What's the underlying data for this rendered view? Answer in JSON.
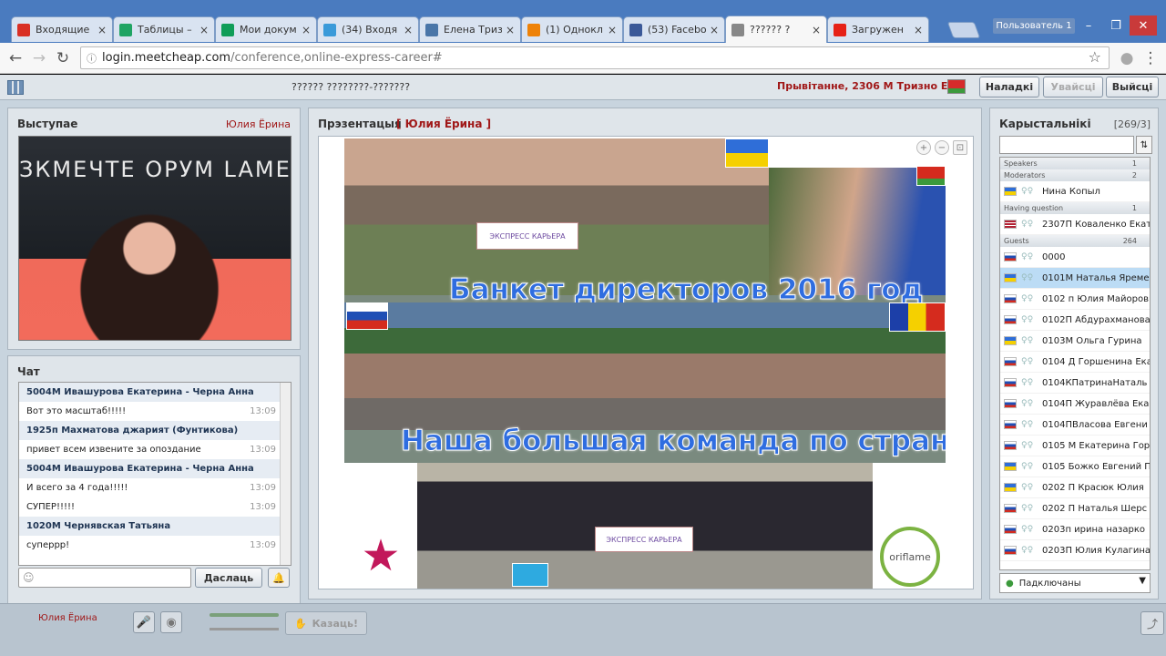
{
  "browser": {
    "tabs": [
      {
        "title": "Входящие",
        "icon": "gmail-icon",
        "color": "#d93025"
      },
      {
        "title": "Таблицы –",
        "icon": "drive-icon",
        "color": "#1fa463"
      },
      {
        "title": "Мои докум",
        "icon": "sheets-icon",
        "color": "#0f9d58"
      },
      {
        "title": "(34) Входя",
        "icon": "mail-icon",
        "color": "#3a9ad9"
      },
      {
        "title": "Елена Триз",
        "icon": "vk-icon",
        "color": "#4a76a8"
      },
      {
        "title": "(1) Однокл",
        "icon": "ok-icon",
        "color": "#ee8208"
      },
      {
        "title": "(53) Facebo",
        "icon": "facebook-icon",
        "color": "#3b5998"
      },
      {
        "title": "?????? ?",
        "icon": "page-icon",
        "color": "#888888"
      },
      {
        "title": "Загружен",
        "icon": "youtube-icon",
        "color": "#e62117"
      }
    ],
    "user_label": "Пользователь 1",
    "url_host": "login.meetcheap.com",
    "url_path": "/conference,online-express-career#"
  },
  "app": {
    "conference_title": "?????? ????????-???????",
    "greeting": "Прывітанне, 2306 М Тризно Е...",
    "buttons": {
      "settings": "Наладкі",
      "login": "Увайсці",
      "exit": "Выйсці"
    }
  },
  "speaker": {
    "title": "Выступае",
    "name": "Юлия Ёрина",
    "banner": "ЗКМЕЧТЕ ОРУМ   LAME"
  },
  "chat": {
    "title": "Чат",
    "messages": [
      {
        "author": "5004М Ивашурова Екатерина - Черна Анна",
        "lines": [
          {
            "text": "Вот это масштаб!!!!!",
            "time": "13:09"
          }
        ]
      },
      {
        "author": "1925п Махматова джарият (Фунтикова)",
        "lines": [
          {
            "text": "привет всем извените за опоздание",
            "time": "13:09"
          }
        ]
      },
      {
        "author": "5004М Ивашурова Екатерина - Черна Анна",
        "lines": [
          {
            "text": "И всего за 4 года!!!!!",
            "time": "13:09"
          },
          {
            "text": "СУПЕР!!!!!",
            "time": "13:09"
          }
        ]
      },
      {
        "author": "1020М Чернявская Татьяна",
        "lines": [
          {
            "text": "суперрр!",
            "time": "13:09"
          }
        ]
      }
    ],
    "send_label": "Даслаць"
  },
  "presentation": {
    "title": "Прэзентацыя",
    "presenter": "[ Юлия Ёрина ]",
    "caption1": "Банкет директоров 2016 год",
    "caption2": "Наша большая команда по странам",
    "banner1": "ЭКСПРЕСС    КАРЬЕРА",
    "banner2": "ЭКСПРЕСС    КАРЬЕРА",
    "brand": "oriflame"
  },
  "users": {
    "title": "Карыстальнікі",
    "count": "[269/3]",
    "groups": [
      {
        "name": "Speakers",
        "count": "1",
        "users": []
      },
      {
        "name": "Moderators",
        "count": "2",
        "users": [
          {
            "name": "Нина Копыл",
            "flag": "ua"
          }
        ]
      },
      {
        "name": "Having question",
        "count": "1",
        "users": [
          {
            "name": "2307П Коваленко Екат",
            "flag": "us"
          }
        ]
      },
      {
        "name": "Guests",
        "count": "264",
        "users": [
          {
            "name": "0000",
            "flag": "ru"
          },
          {
            "name": "0101М Наталья Яреме",
            "flag": "ua",
            "selected": true
          },
          {
            "name": "0102 п Юлия Майоров",
            "flag": "ru"
          },
          {
            "name": "0102П Абдурахманова",
            "flag": "ru"
          },
          {
            "name": "0103М Ольга Гурина",
            "flag": "ua"
          },
          {
            "name": "0104 Д Горшенина Ека",
            "flag": "ru"
          },
          {
            "name": "0104КПатринаНаталь",
            "flag": "ru"
          },
          {
            "name": "0104П Журавлёва Ека",
            "flag": "ru"
          },
          {
            "name": "0104ПВласова Евгени",
            "flag": "ru"
          },
          {
            "name": "0105 М Екатерина Гор",
            "flag": "ru"
          },
          {
            "name": "0105 Божко Евгений П",
            "flag": "ua"
          },
          {
            "name": "0202 П Красюк Юлия",
            "flag": "ua"
          },
          {
            "name": "0202 П Наталья Шерс",
            "flag": "ru"
          },
          {
            "name": "0203п ирина назарко",
            "flag": "ru"
          },
          {
            "name": "0203П Юлия Кулагина",
            "flag": "ru"
          }
        ]
      }
    ],
    "filter_label": "Падключаны"
  },
  "bottom": {
    "name": "Юлия Ёрина",
    "say_label": "Казаць!"
  },
  "colors": {
    "flag_ru": [
      "#ffffff",
      "#1f4fb5",
      "#d52b1e"
    ],
    "flag_ua": [
      "#2f6ed8",
      "#f5d000"
    ],
    "flag_us": [
      "#b22234",
      "#ffffff"
    ]
  }
}
